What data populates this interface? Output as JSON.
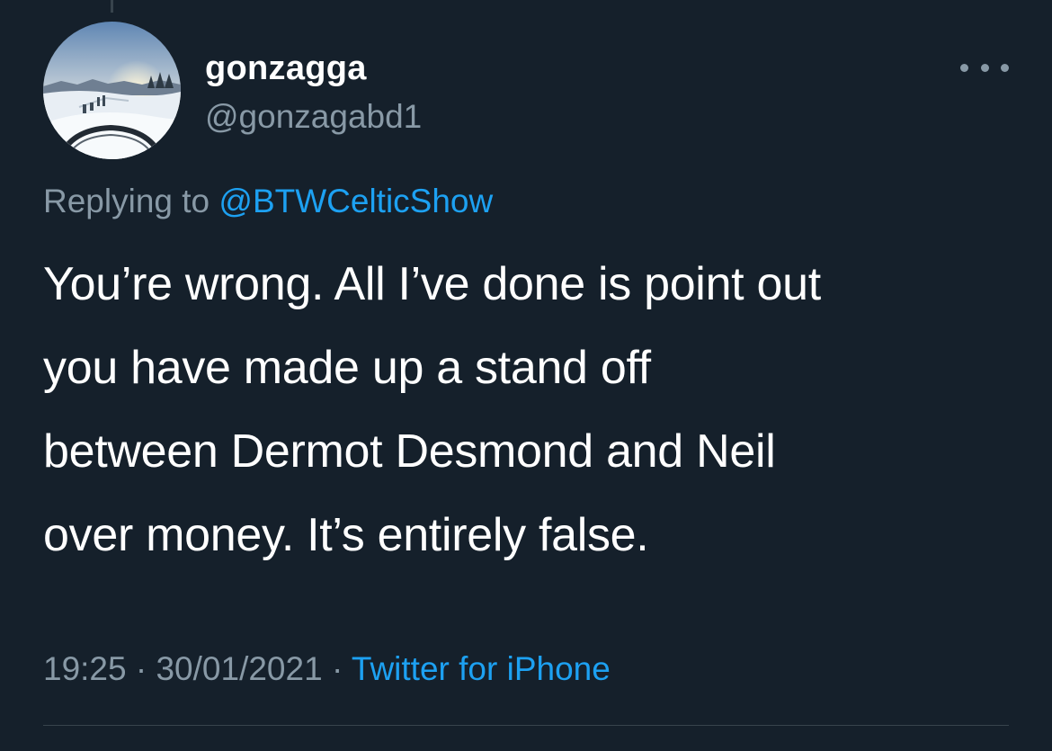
{
  "tweet": {
    "author": {
      "display_name": "gonzagga",
      "handle": "@gonzagabd1",
      "avatar_icon": "snowy-landscape-avatar"
    },
    "more_icon": "more-options-icon",
    "replying_label": "Replying to",
    "replying_to": "@BTWCelticShow",
    "text_lines": [
      "You’re wrong. All I’ve done is point out",
      "you have made up a stand off",
      "between Dermot Desmond and Neil",
      "over money. It’s entirely false."
    ],
    "time": "19:25",
    "separator": "·",
    "date": "30/01/2021",
    "source": "Twitter for iPhone"
  },
  "colors": {
    "background": "#15202b",
    "text": "#ffffff",
    "secondary": "#8899a6",
    "accent": "#1da1f2",
    "divider": "#38444d"
  }
}
